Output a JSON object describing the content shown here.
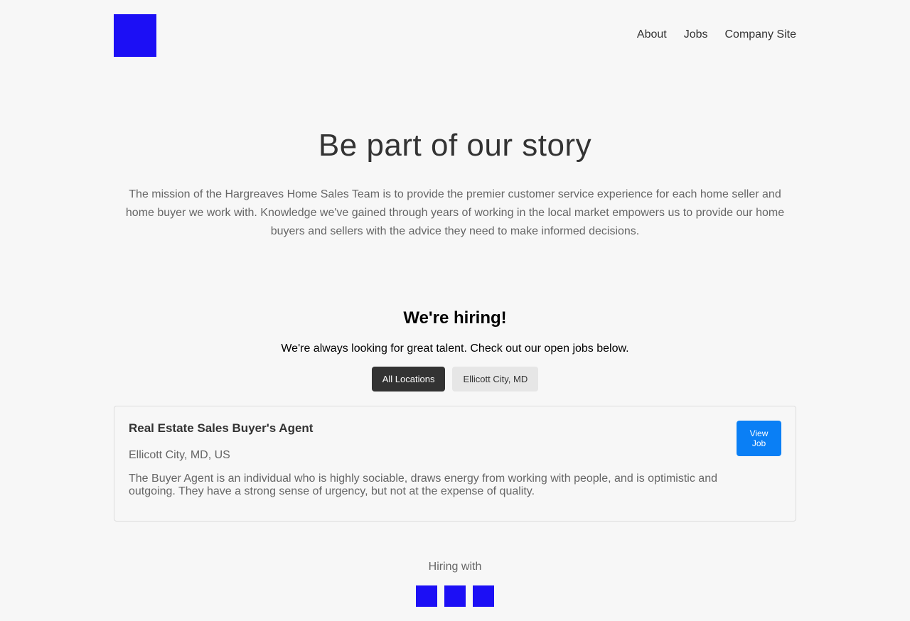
{
  "header": {
    "logo_icon": "company-logo",
    "logo_color": "#1c0ff5",
    "nav": {
      "about": "About",
      "jobs": "Jobs",
      "company_site": "Company Site"
    }
  },
  "hero": {
    "title": "Be part of our story",
    "text": "The mission of the Hargreaves Home Sales Team is to provide the premier customer service experience for each home seller and home buyer we work with. Knowledge we've gained through years of working in the local market empowers us to provide our home buyers and sellers with the advice they need to make informed decisions."
  },
  "hiring": {
    "title": "We're hiring!",
    "subtitle": "We're always looking for great talent. Check out our open jobs below.",
    "filters": {
      "all": "All Locations",
      "ellicott": "Ellicott City, MD"
    },
    "jobs": [
      {
        "title": "Real Estate Sales Buyer's Agent",
        "location": "Ellicott City, MD, US",
        "description": "The Buyer Agent is an individual who is highly sociable, draws energy from working with people, and is optimistic and outgoing. They have a strong sense of urgency, but not at the expense of quality.",
        "button": "View Job"
      }
    ]
  },
  "footer": {
    "hiring_with": "Hiring with",
    "social_icons": [
      "social-icon",
      "social-icon",
      "social-icon"
    ]
  },
  "colors": {
    "accent_blue": "#0a7ff5",
    "placeholder_blue": "#1c0ff5",
    "active_filter": "#333333",
    "background": "#f7f7f7"
  }
}
